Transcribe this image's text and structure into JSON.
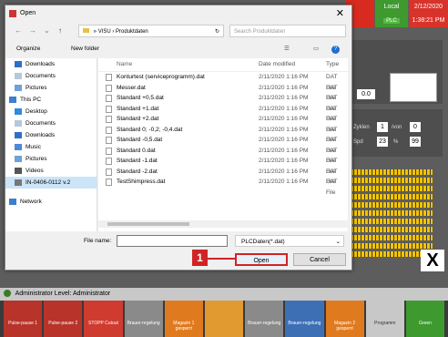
{
  "background": {
    "top_red": "",
    "status_local": "Local",
    "status_plc": "PLC",
    "date": "2/12/2020",
    "time": "1:38:21 PM",
    "value_box": "0.0",
    "cycles_label": "Zyklen",
    "cycles_value": "1",
    "cycles_of": "/von",
    "cycles_total": "0",
    "speed_label": "Spd",
    "speed_value": "23",
    "speed_pct": "%",
    "speed_box": "99",
    "close_x": "X",
    "status_text": "Administrator  Level: Administrator",
    "function_keys": [
      "Pulse-pause 1",
      "Pulse-pause 2",
      "STOPP Cutout",
      "Brauer-regelung",
      "Magazin 1 gesperrt",
      "",
      "Brauer-regelung",
      "Brauer-regelung",
      "Magazin 2 gesperrt",
      "Programm",
      "Green"
    ]
  },
  "dialog": {
    "title": "Open",
    "path": [
      "VISU",
      "Produktdaten"
    ],
    "search_placeholder": "Search Produktdaten",
    "toolbar": {
      "organize": "Organize",
      "new_folder": "New folder"
    },
    "tree": [
      "Downloads",
      "Documents",
      "Pictures",
      "This PC",
      "Desktop",
      "Documents",
      "Downloads",
      "Music",
      "Pictures",
      "Videos",
      "IN-0406-0112 v.2",
      "Network"
    ],
    "columns": {
      "name": "Name",
      "date": "Date modified",
      "type": "Type"
    },
    "files": [
      {
        "name": "Konturtest (serviceprogramm).dat",
        "date": "2/11/2020 1:16 PM",
        "type": "DAT File"
      },
      {
        "name": "Messer.dat",
        "date": "2/11/2020 1:16 PM",
        "type": "DAT File"
      },
      {
        "name": "Standard +0,5.dat",
        "date": "2/11/2020 1:16 PM",
        "type": "DAT File"
      },
      {
        "name": "Standard +1.dat",
        "date": "2/11/2020 1:16 PM",
        "type": "DAT File"
      },
      {
        "name": "Standard +2.dat",
        "date": "2/11/2020 1:16 PM",
        "type": "DAT File"
      },
      {
        "name": "Standard 0; -0,2; -0,4.dat",
        "date": "2/11/2020 1:16 PM",
        "type": "DAT File"
      },
      {
        "name": "Standard -0,5.dat",
        "date": "2/11/2020 1:16 PM",
        "type": "DAT File"
      },
      {
        "name": "Standard 0.dat",
        "date": "2/11/2020 1:16 PM",
        "type": "DAT File"
      },
      {
        "name": "Standard -1.dat",
        "date": "2/11/2020 1:16 PM",
        "type": "DAT File"
      },
      {
        "name": "Standard -2.dat",
        "date": "2/11/2020 1:16 PM",
        "type": "DAT File"
      },
      {
        "name": "TestShimpress.dat",
        "date": "2/11/2020 1:16 PM",
        "type": "DAT File"
      }
    ],
    "file_name_label": "File name:",
    "file_name_value": "",
    "file_type": "PLCDaten(*.dat)",
    "open_label": "Open",
    "cancel_label": "Cancel",
    "marker": "1"
  },
  "colors": {
    "accent_red": "#d02424",
    "plc_green": "#3e9a2f",
    "grid_yellow": "#f5c400"
  }
}
